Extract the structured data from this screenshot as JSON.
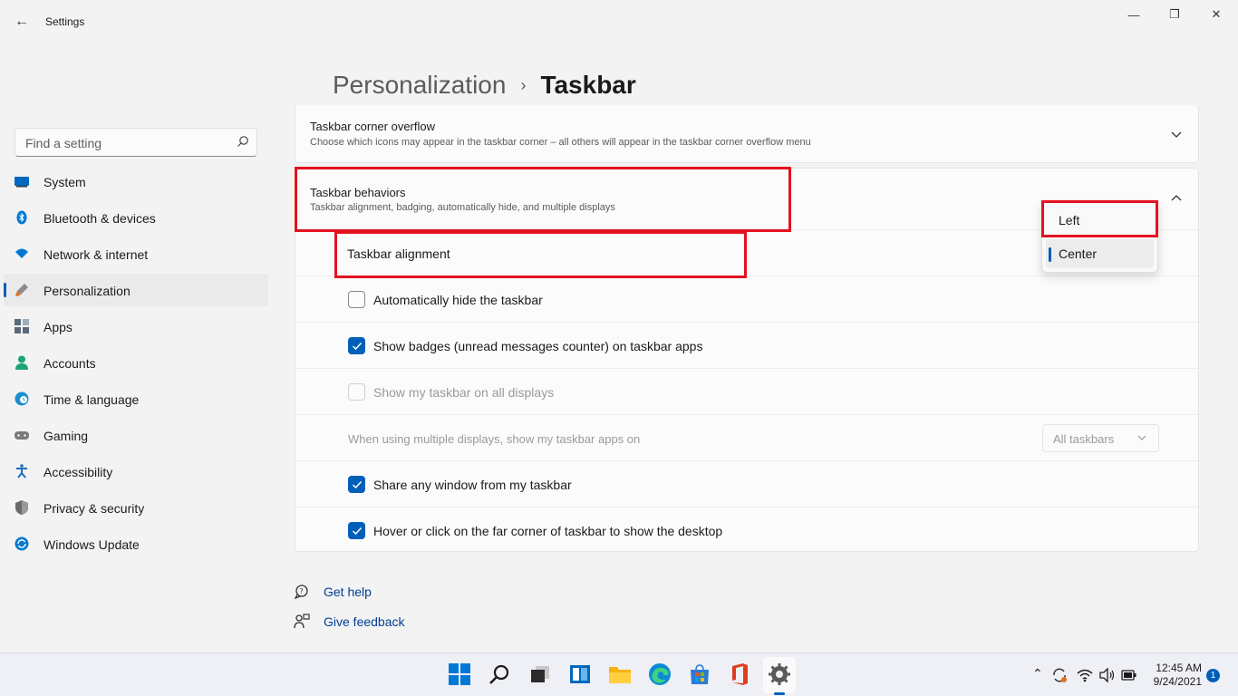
{
  "window": {
    "title": "Settings",
    "back_glyph": "←",
    "minimize_glyph": "—",
    "maximize_glyph": "❐",
    "close_glyph": "✕"
  },
  "search": {
    "placeholder": "Find a setting",
    "icon": "search-icon"
  },
  "sidebar": {
    "items": [
      {
        "label": "System",
        "icon": "system-icon",
        "color": "#0067c0"
      },
      {
        "label": "Bluetooth & devices",
        "icon": "bluetooth-icon",
        "color": "#0078d4"
      },
      {
        "label": "Network & internet",
        "icon": "wifi-icon",
        "color": "#0078d4"
      },
      {
        "label": "Personalization",
        "icon": "brush-icon",
        "color": "#e07020",
        "active": true
      },
      {
        "label": "Apps",
        "icon": "apps-icon",
        "color": "#5a6a7a"
      },
      {
        "label": "Accounts",
        "icon": "accounts-icon",
        "color": "#1da37a"
      },
      {
        "label": "Time & language",
        "icon": "globe-icon",
        "color": "#1a8fd0"
      },
      {
        "label": "Gaming",
        "icon": "gamepad-icon",
        "color": "#7a7a7a"
      },
      {
        "label": "Accessibility",
        "icon": "accessibility-icon",
        "color": "#1a6fc0"
      },
      {
        "label": "Privacy & security",
        "icon": "shield-icon",
        "color": "#6a6a6a"
      },
      {
        "label": "Windows Update",
        "icon": "update-icon",
        "color": "#0a7ad0"
      }
    ]
  },
  "header": {
    "parent": "Personalization",
    "separator": "›",
    "current": "Taskbar"
  },
  "overflow_card": {
    "title": "Taskbar corner overflow",
    "description": "Choose which icons may appear in the taskbar corner – all others will appear in the taskbar corner overflow menu"
  },
  "behaviors_card": {
    "title": "Taskbar behaviors",
    "description": "Taskbar alignment, badging, automatically hide, and multiple displays",
    "alignment_label": "Taskbar alignment",
    "alignment_options": [
      "Left",
      "Center"
    ],
    "alignment_selected": "Center",
    "options": [
      {
        "label": "Automatically hide the taskbar",
        "checked": false,
        "disabled": false
      },
      {
        "label": "Show badges (unread messages counter) on taskbar apps",
        "checked": true,
        "disabled": false
      },
      {
        "label": "Show my taskbar on all displays",
        "checked": false,
        "disabled": true
      }
    ],
    "multi_display": {
      "label": "When using multiple displays, show my taskbar apps on",
      "value": "All taskbars"
    },
    "options_after": [
      {
        "label": "Share any window from my taskbar",
        "checked": true
      },
      {
        "label": "Hover or click on the far corner of taskbar to show the desktop",
        "checked": true
      }
    ]
  },
  "links": {
    "get_help": "Get help",
    "give_feedback": "Give feedback"
  },
  "taskbar": {
    "apps": [
      "start-icon",
      "search-icon",
      "task-view-icon",
      "widgets-icon",
      "file-explorer-icon",
      "edge-icon",
      "store-icon",
      "office-icon",
      "settings-icon"
    ],
    "clock_time": "12:45 AM",
    "clock_date": "9/24/2021",
    "notification_count": "1",
    "tray_chevron": "⌃"
  },
  "colors": {
    "accent": "#005fb8",
    "highlight": "#e3121f"
  }
}
